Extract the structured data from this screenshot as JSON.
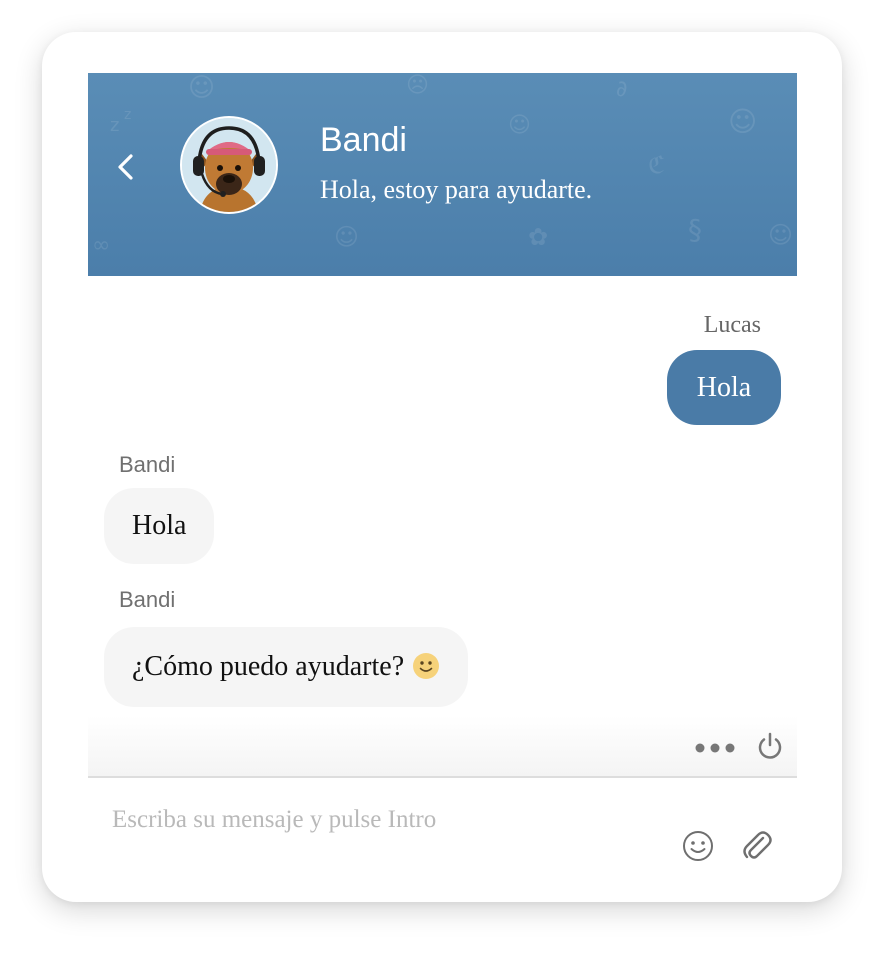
{
  "header": {
    "agent_name": "Bandi",
    "agent_status": "Hola, estoy para ayudarte.",
    "icons": {
      "back": "chevron-left-icon",
      "avatar": "dog-with-headset-avatar"
    },
    "colors": {
      "background": "#4e82ae",
      "text": "#ffffff"
    }
  },
  "messages": [
    {
      "sender": "Lucas",
      "text": "Hola",
      "direction": "outgoing"
    },
    {
      "sender": "Bandi",
      "text": "Hola",
      "direction": "incoming"
    },
    {
      "sender": "Bandi",
      "text": "¿Cómo puedo ayudarte?",
      "direction": "incoming",
      "emoji": "slightly-smiling-face-icon"
    }
  ],
  "toolbar": {
    "more_icon": "more-horizontal-icon",
    "power_icon": "power-icon"
  },
  "composer": {
    "placeholder": "Escriba su mensaje y pulse Intro",
    "value": "",
    "emoji_icon": "emoji-icon",
    "attach_icon": "paperclip-icon"
  },
  "colors": {
    "outgoing_bubble": "#4a7ba7",
    "incoming_bubble": "#f5f5f5",
    "placeholder": "#b9b9b9"
  }
}
